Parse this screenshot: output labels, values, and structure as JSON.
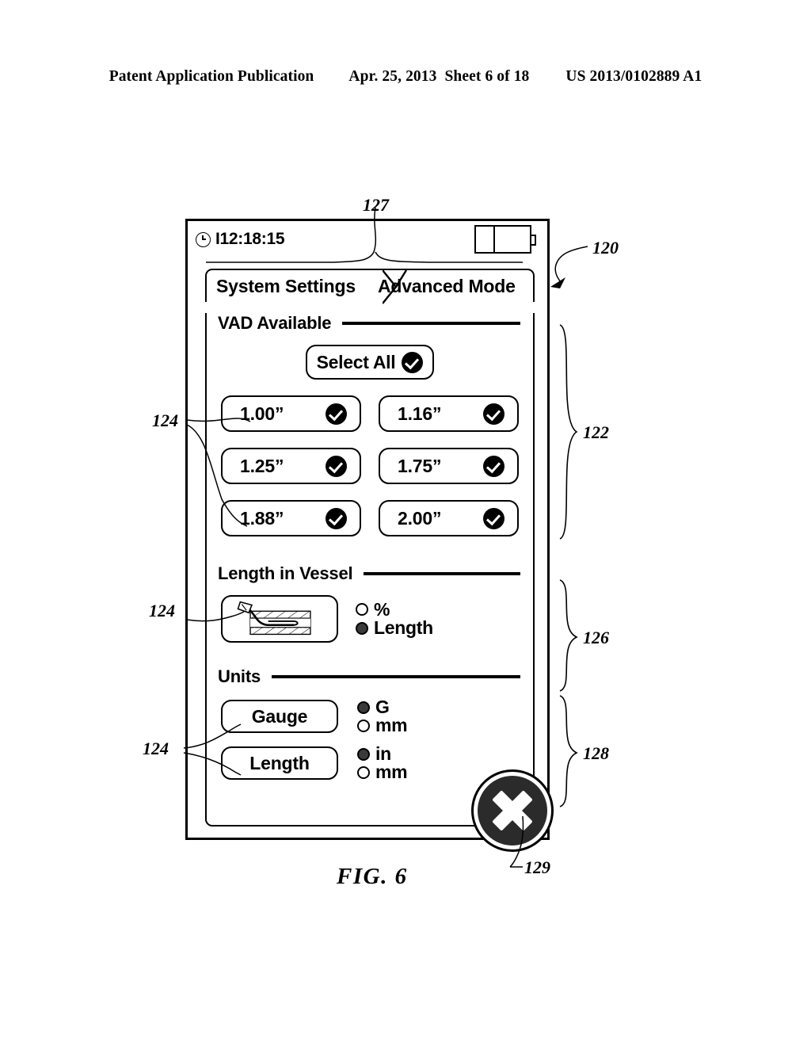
{
  "publication_header": {
    "publication": "Patent Application Publication",
    "date": "Apr. 25, 2013",
    "sheet": "Sheet 6 of 18",
    "number": "US 2013/0102889 A1"
  },
  "figure": {
    "caption": "FIG. 6"
  },
  "device": {
    "status_bar": {
      "clock_icon": "clock-icon",
      "time": "I12:18:15",
      "battery_icon": "battery-icon"
    },
    "tabs": [
      {
        "label": "System Settings",
        "active": true
      },
      {
        "label": "Advanced Mode",
        "active": false
      }
    ],
    "sections": {
      "vad": {
        "title": "VAD Available",
        "select_all": {
          "label": "Select All",
          "icon": "check-badge-icon",
          "checked": true
        },
        "options": [
          {
            "label": "1.00”",
            "checked": true
          },
          {
            "label": "1.16”",
            "checked": true
          },
          {
            "label": "1.25”",
            "checked": true
          },
          {
            "label": "1.75”",
            "checked": true
          },
          {
            "label": "1.88”",
            "checked": true
          },
          {
            "label": "2.00”",
            "checked": true
          }
        ]
      },
      "length_in_vessel": {
        "title": "Length in Vessel",
        "preview_icon": "vessel-catheter-icon",
        "radios": [
          {
            "label": "%",
            "selected": false
          },
          {
            "label": "Length",
            "selected": true
          }
        ]
      },
      "units": {
        "title": "Units",
        "rows": [
          {
            "button_label": "Gauge",
            "radios": [
              {
                "label": "G",
                "selected": true
              },
              {
                "label": "mm",
                "selected": false
              }
            ]
          },
          {
            "button_label": "Length",
            "radios": [
              {
                "label": "in",
                "selected": true
              },
              {
                "label": "mm",
                "selected": false
              }
            ]
          }
        ]
      }
    },
    "close_button": {
      "icon": "close-x-icon"
    }
  },
  "reference_numerals": {
    "device": "120",
    "vad_section": "122",
    "button": "124",
    "button_alt": "124",
    "button_alt2": "124",
    "length_section": "126",
    "status_bar": "127",
    "units_section": "128",
    "close_button": "129"
  }
}
